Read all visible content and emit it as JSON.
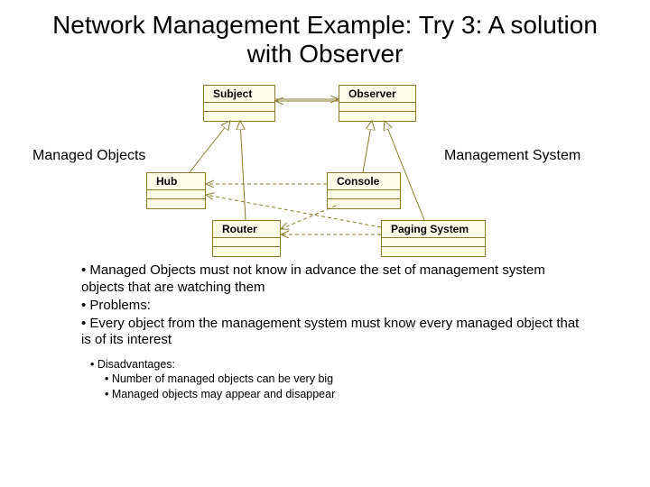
{
  "title": "Network Management Example: Try 3: A solution with Observer",
  "labels": {
    "left": "Managed Objects",
    "right": "Management System"
  },
  "classes": {
    "subject": "Subject",
    "observer": "Observer",
    "hub": "Hub",
    "router": "Router",
    "console": "Console",
    "paging": "Paging System"
  },
  "notes": {
    "b1": "• Managed Objects must not know in advance the set of management system objects that are watching them",
    "b2": "• Problems:",
    "b3": "• Every object from the management system must know every managed object that is of its interest",
    "sub_title": "• Disadvantages:",
    "sub1": "•   Number  of managed objects can be very big",
    "sub2": "•   Managed objects may appear and disappear"
  }
}
